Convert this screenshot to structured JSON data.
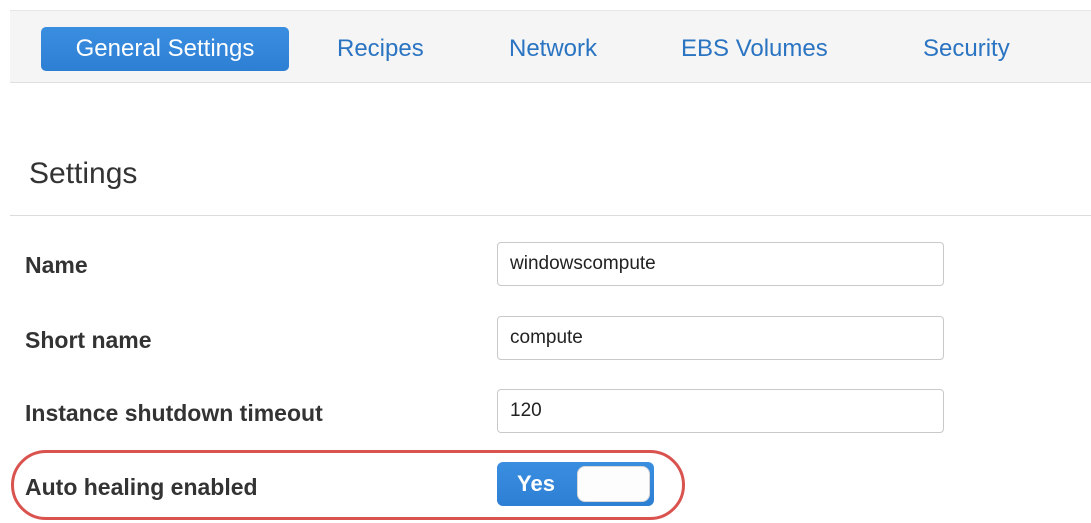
{
  "tabs": [
    {
      "label": "General Settings",
      "active": true
    },
    {
      "label": "Recipes",
      "active": false
    },
    {
      "label": "Network",
      "active": false
    },
    {
      "label": "EBS Volumes",
      "active": false
    },
    {
      "label": "Security",
      "active": false
    }
  ],
  "section": {
    "title": "Settings"
  },
  "fields": {
    "name": {
      "label": "Name",
      "value": "windowscompute"
    },
    "short_name": {
      "label": "Short name",
      "value": "compute"
    },
    "shutdown_timeout": {
      "label": "Instance shutdown timeout",
      "value": "120"
    },
    "auto_healing": {
      "label": "Auto healing enabled",
      "toggle_label": "Yes",
      "enabled": true
    }
  },
  "colors": {
    "accent": "#2e86de",
    "link": "#2a74c2",
    "highlight": "#d9534f"
  }
}
